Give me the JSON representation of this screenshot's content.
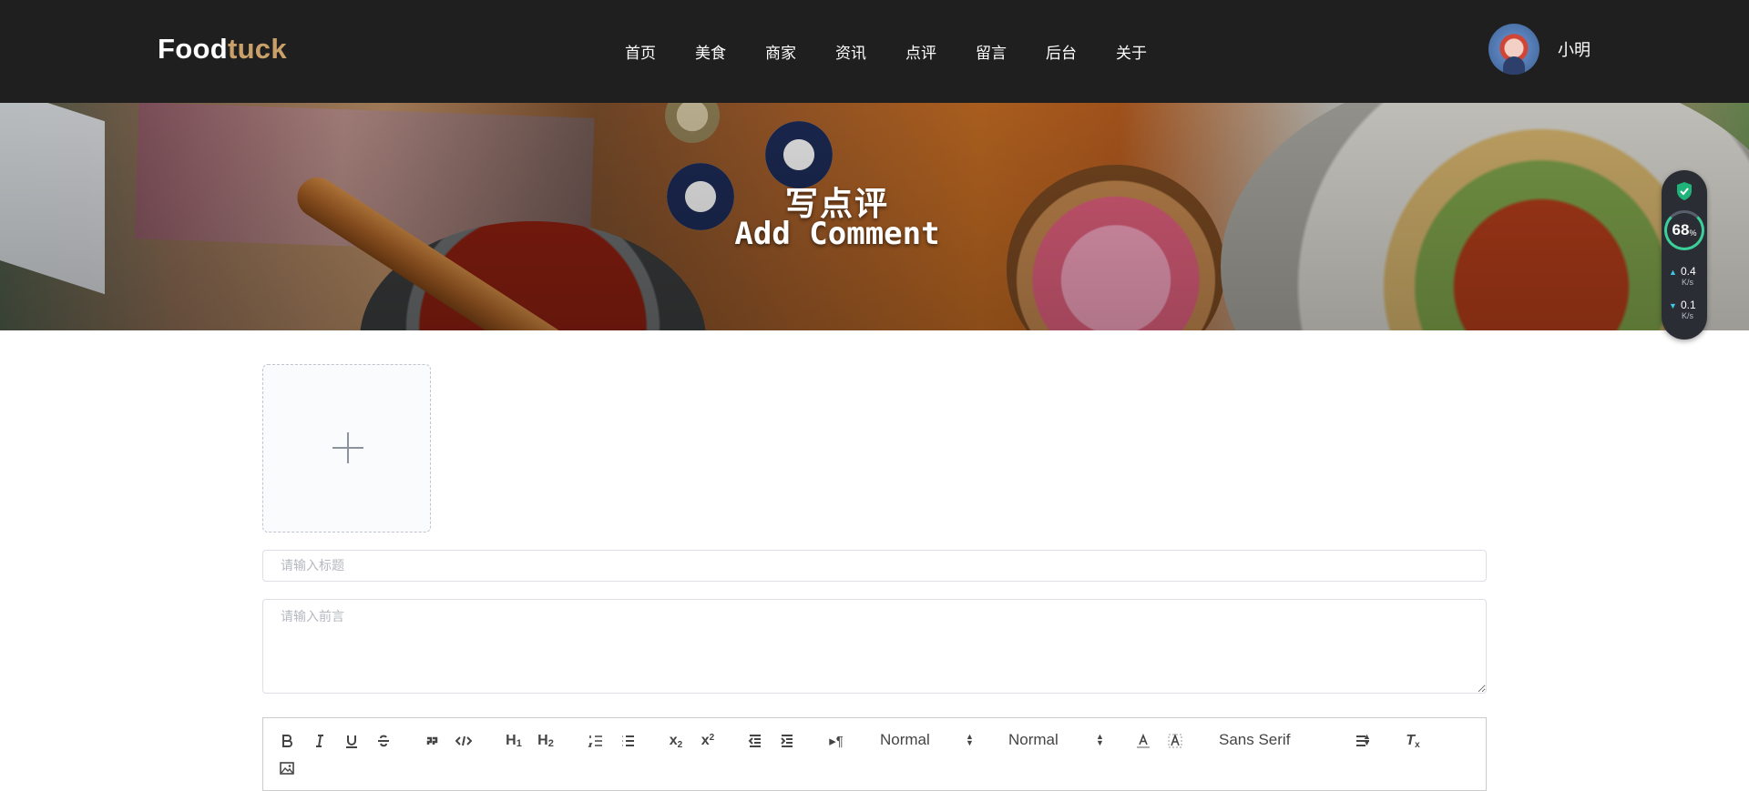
{
  "header": {
    "logo_part1": "Food",
    "logo_part2": "tuck",
    "nav": [
      "首页",
      "美食",
      "商家",
      "资讯",
      "点评",
      "留言",
      "后台",
      "关于"
    ],
    "username": "小明"
  },
  "banner": {
    "title_cn": "写点评",
    "title_en": "Add Comment"
  },
  "widget": {
    "percent": "68",
    "percent_unit": "%",
    "upload_speed": "0.4",
    "download_speed": "0.1",
    "speed_unit": "K/s",
    "accent": "#3ccf9a"
  },
  "form": {
    "title_placeholder": "请输入标题",
    "intro_placeholder": "请输入前言"
  },
  "editor_toolbar": {
    "header_select": "Normal",
    "size_select": "Normal",
    "font_select": "Sans Serif",
    "buttons": [
      "bold",
      "italic",
      "underline",
      "strike",
      "blockquote",
      "code-block",
      "header-1",
      "header-2",
      "ordered-list",
      "bullet-list",
      "subscript",
      "superscript",
      "outdent",
      "indent",
      "direction",
      "color",
      "background",
      "align",
      "clean",
      "image"
    ]
  }
}
